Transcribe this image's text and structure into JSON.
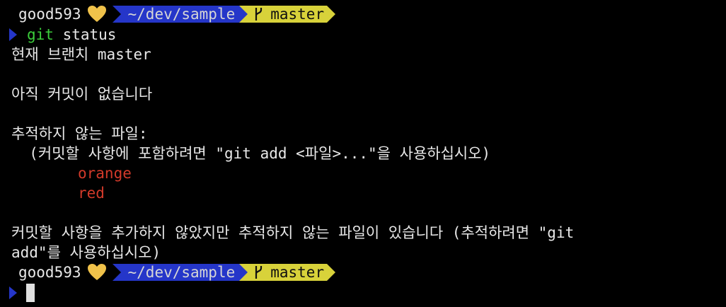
{
  "prompt": {
    "user": "good593",
    "path": "~/dev/sample",
    "branch": "master",
    "heart_color": "#f0c24a",
    "path_bg": "#2536c9",
    "branch_bg": "#d8d23a"
  },
  "command": {
    "name": "git",
    "args": " status"
  },
  "output": {
    "line1": "현재 브랜치 master",
    "line2": "아직 커밋이 없습니다",
    "line3": "추적하지 않는 파일:",
    "line4": "  (커밋할 사항에 포함하려면 \"git add <파일>...\"을 사용하십시오)",
    "untracked": [
      "orange",
      "red"
    ],
    "line5": "커밋할 사항을 추가하지 않았지만 추적하지 않는 파일이 있습니다 (추적하려면 \"git",
    "line6": "add\"를 사용하십시오)"
  },
  "colors": {
    "untracked": "#d23a2a",
    "command": "#3ccf3c"
  }
}
